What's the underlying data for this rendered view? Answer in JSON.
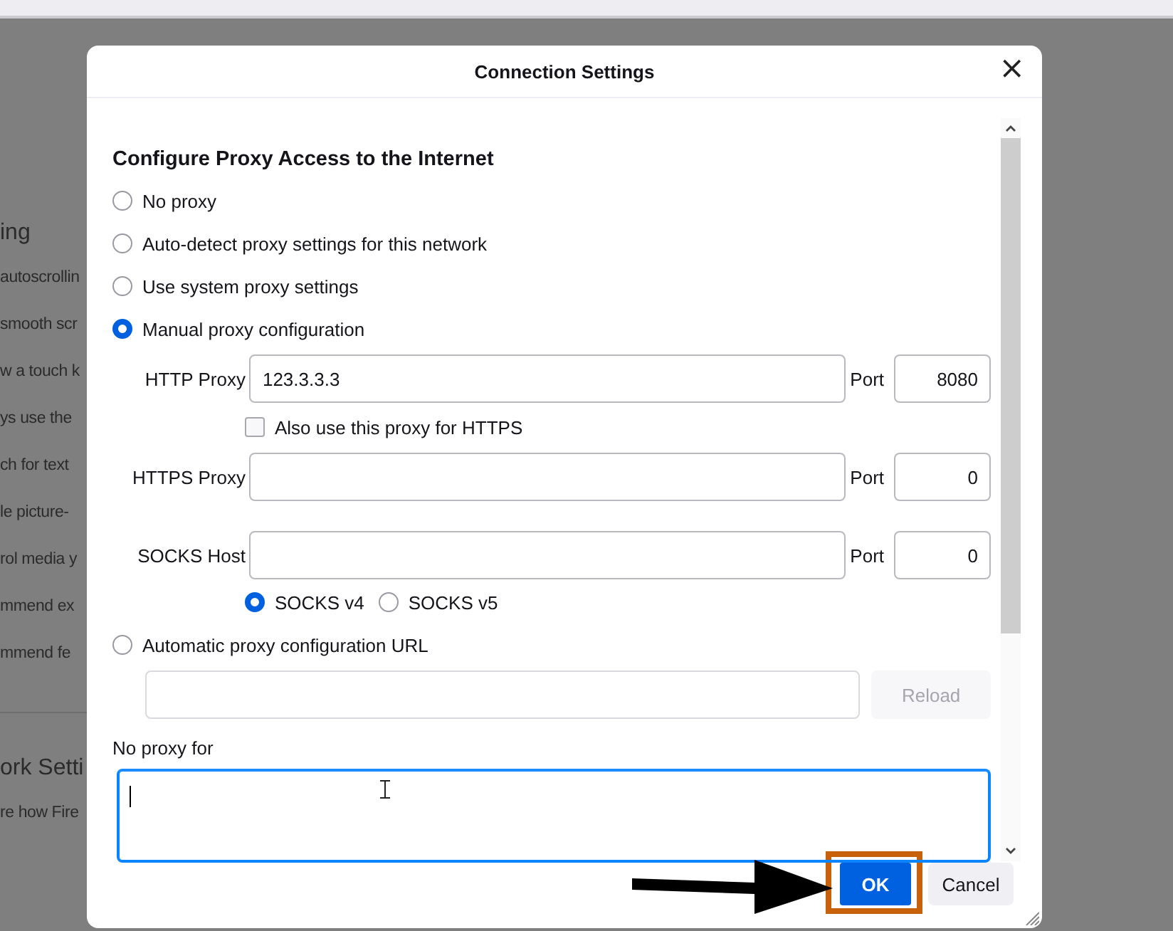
{
  "background_page": {
    "lines": [
      {
        "text": "ing",
        "kind": "heading"
      },
      {
        "text": "autoscrollin",
        "kind": "text"
      },
      {
        "text": "smooth scr",
        "kind": "text"
      },
      {
        "text": "w a touch k",
        "kind": "text"
      },
      {
        "text": "ys use the",
        "kind": "text"
      },
      {
        "text": "ch for text",
        "kind": "text"
      },
      {
        "text": "le picture-",
        "kind": "text"
      },
      {
        "text": "rol media y",
        "kind": "text"
      },
      {
        "text": "mmend ex",
        "kind": "text"
      },
      {
        "text": "mmend fe",
        "kind": "text"
      },
      {
        "text": "ork Setti",
        "kind": "heading"
      },
      {
        "text": "re how Fire",
        "kind": "text"
      }
    ]
  },
  "dialog": {
    "title": "Connection Settings",
    "close": "×",
    "heading": "Configure Proxy Access to the Internet",
    "proxy_modes": [
      {
        "label": "No proxy",
        "selected": false,
        "kind": "plain"
      },
      {
        "label": "Auto-detect proxy settings for this network",
        "selected": false,
        "kind": "plain"
      },
      {
        "label": "Use system proxy settings",
        "selected": false,
        "kind": "plain"
      },
      {
        "label": "Manual proxy configuration",
        "selected": true,
        "kind": "manual"
      },
      {
        "label": "Automatic proxy configuration URL",
        "selected": false,
        "kind": "auto_url"
      }
    ],
    "http_proxy": {
      "label": "HTTP Proxy",
      "value": "123.3.3.3",
      "port_label": "Port",
      "port": "8080"
    },
    "also_https": {
      "label": "Also use this proxy for HTTPS",
      "checked": false
    },
    "https_proxy": {
      "label": "HTTPS Proxy",
      "port_label": "Port",
      "port": "0"
    },
    "socks_host": {
      "label": "SOCKS Host",
      "port_label": "Port",
      "port": "0"
    },
    "socks_versions": [
      {
        "label": "SOCKS v4",
        "selected": true
      },
      {
        "label": "SOCKS v5",
        "selected": false
      }
    ],
    "reload_button": {
      "label": "Reload",
      "disabled": true
    },
    "no_proxy_for": {
      "label": "No proxy for",
      "focused": true
    },
    "buttons": [
      {
        "label": "OK",
        "kind": "primary",
        "highlighted": true
      },
      {
        "label": "Cancel",
        "kind": "secondary",
        "highlighted": false
      }
    ]
  }
}
